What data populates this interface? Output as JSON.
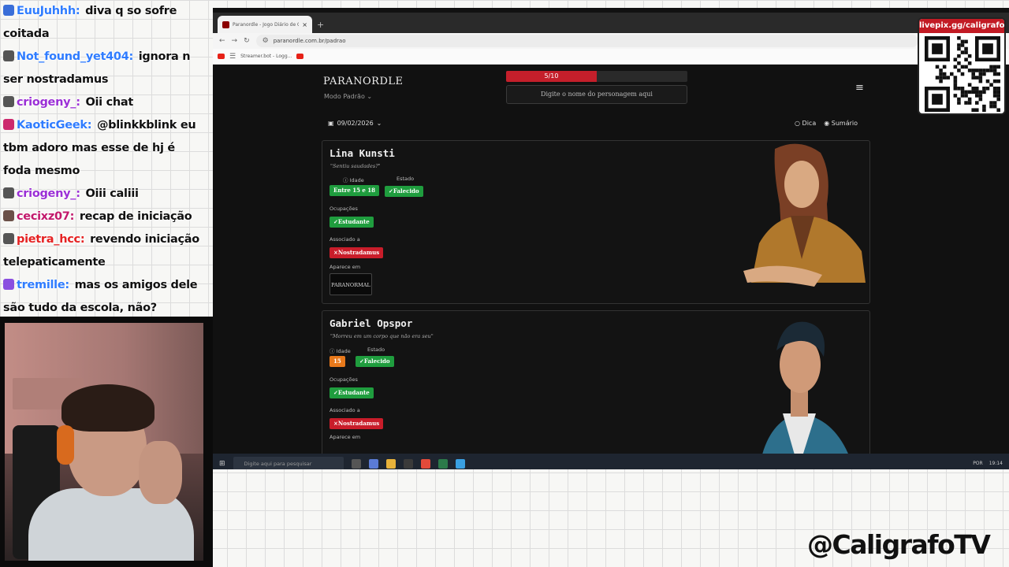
{
  "chat": [
    {
      "user": "EuuJuhhh:",
      "msg": "diva q so sofre coitada",
      "color": "#2f7cff",
      "badge": "#3a6ed8"
    },
    {
      "user": "Not_found_yet404:",
      "msg": "ignora n ser nostradamus",
      "color": "#2f7cff",
      "badge": "#555555"
    },
    {
      "user": "criogeny_:",
      "msg": "Oii chat",
      "color": "#9b2fd6",
      "badge": "#555555"
    },
    {
      "user": "KaoticGeek:",
      "msg": "@blinkkblink eu tbm adoro mas esse de hj é foda mesmo",
      "color": "#2f7cff",
      "badge": "#cc2a6e"
    },
    {
      "user": "criogeny_:",
      "msg": "Oiii caliii",
      "color": "#9b2fd6",
      "badge": "#555555"
    },
    {
      "user": "cecixz07:",
      "msg": "recap de iniciação",
      "color": "#c2186b",
      "badge": "#6b5048"
    },
    {
      "user": "pietra_hcc:",
      "msg": "revendo iniciação telepaticamente",
      "color": "#e52222",
      "badge": "#555555"
    },
    {
      "user": "tremille:",
      "msg": "mas os amigos dele são tudo da escola, não?",
      "color": "#2f7cff",
      "badge": "#8a4fe0"
    }
  ],
  "browser": {
    "tab_title": "Paranordle - Jogo Diário de O...",
    "tab_close": "×",
    "new_tab": "+",
    "url": "paranordle.com.br/padrao",
    "bookmark_label": "Streamer.bot - Logg..."
  },
  "site": {
    "logo": "PARANORDLE",
    "mode": "Modo Padrão",
    "progress_label": "5/10",
    "progress_fraction": 0.5,
    "search_placeholder": "Digite o nome do personagem aqui",
    "date": "09/02/2026",
    "dica": "Dica",
    "sumario": "Sumário"
  },
  "cards": [
    {
      "name": "Lina Kunsti",
      "quote": "\"Sentiu saudades?\"",
      "idade_label": "Idade",
      "idade": "Entre 15 e 18",
      "estado_label": "Estado",
      "estado": "Falecido",
      "ocupacoes_label": "Ocupações",
      "ocupacao": "Estudante",
      "associado_label": "Associado a",
      "associado": "Nostradamus",
      "aparece_label": "Aparece em",
      "series": "PARANORMAL"
    },
    {
      "name": "Gabriel Opspor",
      "quote": "\"Morreu em um corpo que não era seu\"",
      "idade_label": "Idade",
      "idade": "15",
      "estado_label": "Estado",
      "estado": "Falecido",
      "ocupacoes_label": "Ocupações",
      "ocupacao": "Estudante",
      "associado_label": "Associado a",
      "associado": "Nostradamus",
      "aparece_label": "Aparece em"
    }
  ],
  "taskbar": {
    "search": "Digite aqui para pesquisar",
    "lang": "POR",
    "time": "19:14"
  },
  "overlay": {
    "qr_title": "livepix.gg/caligrafo",
    "handle": "@CaligrafoTV"
  }
}
